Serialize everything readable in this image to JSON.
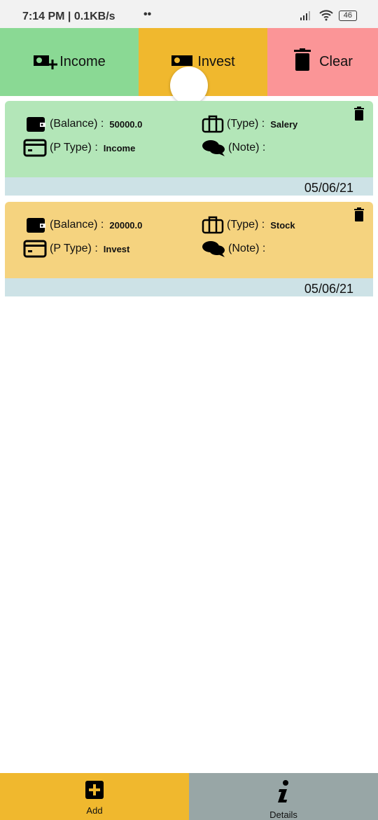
{
  "status_bar": {
    "time": "7:14 PM | 0.1KB/s",
    "dots": "••",
    "battery": "46"
  },
  "top_actions": [
    {
      "label": "Income",
      "icon": "money-plus-icon",
      "color": "#8ad994"
    },
    {
      "label": "Invest",
      "icon": "money-check-icon",
      "color": "#f0b82e"
    },
    {
      "label": "Clear",
      "icon": "trash-icon",
      "color": "#fb9597"
    }
  ],
  "records": [
    {
      "balance_label": "(Balance) :",
      "balance": "50000.0",
      "type_label": "(Type) :",
      "type": "Salery",
      "ptype_label": "(P Type) :",
      "ptype": "Income",
      "note_label": "(Note) :",
      "note": "",
      "date": "05/06/21",
      "color": "#b3e6b8"
    },
    {
      "balance_label": "(Balance) :",
      "balance": "20000.0",
      "type_label": "(Type) :",
      "type": "Stock",
      "ptype_label": "(P Type) :",
      "ptype": "Invest",
      "note_label": "(Note) :",
      "note": "",
      "date": "05/06/21",
      "color": "#f5d37f"
    }
  ],
  "bottom_nav": [
    {
      "label": "Add",
      "icon": "plus-square-icon",
      "color": "#f0b82e"
    },
    {
      "label": "Details",
      "icon": "info-icon",
      "color": "#98a6a6"
    }
  ]
}
